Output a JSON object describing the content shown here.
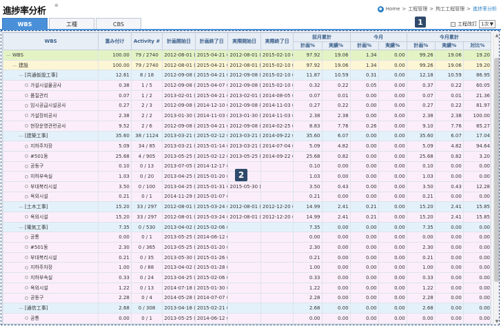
{
  "page": {
    "title": "進捗率分析",
    "title_mark": "⊕",
    "breadcrumb": [
      "Home",
      ">",
      "工程管理",
      ">",
      "拘工工程管理",
      ">",
      "進捗率分析"
    ]
  },
  "tabs": [
    {
      "label": "WBS",
      "active": true
    },
    {
      "label": "工種",
      "active": false
    },
    {
      "label": "CBS",
      "active": false
    }
  ],
  "revision": {
    "label": "工程改訂",
    "value": "1次",
    "arrow": "▼"
  },
  "callouts": [
    "1",
    "2"
  ],
  "table": {
    "header_groups": {
      "wbs": "WBS",
      "weight": "重み付け",
      "activity": "Activity #",
      "plan_start": "計画開始日",
      "plan_end": "計画終了日",
      "act_start": "実際開始日",
      "act_end": "実際終了日",
      "cum_prev": "前月累計",
      "this_month": "今月",
      "cum_this": "今月累計"
    },
    "sub_headers": [
      "計画%",
      "実績%",
      "計画%",
      "実績%",
      "計画%",
      "実績%",
      "対比%"
    ],
    "rows": [
      {
        "level": 0,
        "indent": 0,
        "prefix": "—",
        "wbs": "WBS",
        "weight": "100.00",
        "activity": "79 / 2740",
        "ps": "2012-08-01 (",
        "pe": "2015-04-21 (",
        "as": "2012-08-01 (",
        "ae": "2015-02-10 (",
        "v": [
          "97.92",
          "19.06",
          "1.34",
          "0.00",
          "99.26",
          "19.06",
          "19.20"
        ]
      },
      {
        "level": 1,
        "indent": 1,
        "prefix": "—",
        "wbs": "建設",
        "weight": "100.00",
        "activity": "79 / 2740",
        "ps": "2012-08-01 (",
        "pe": "2015-04-21 (",
        "as": "2012-08-01 (",
        "ae": "2015-02-10 (",
        "v": [
          "97.92",
          "19.06",
          "1.34",
          "0.00",
          "99.26",
          "19.06",
          "19.20"
        ]
      },
      {
        "level": 2,
        "indent": 2,
        "prefix": "—",
        "wbs": "[共通仮設工事]",
        "weight": "12.61",
        "activity": "8 / 18",
        "ps": "2012-09-08 (",
        "pe": "2015-04-21 (",
        "as": "2012-09-08 (",
        "ae": "2015-02-10 (",
        "v": [
          "11.87",
          "10.59",
          "0.31",
          "0.00",
          "12.18",
          "10.59",
          "86.95"
        ]
      },
      {
        "level": 3,
        "indent": 3,
        "prefix": "◇",
        "wbs": "가설시설물공사",
        "weight": "0.38",
        "activity": "1 / 5",
        "ps": "2012-09-08 (",
        "pe": "2015-04-07 (",
        "as": "2012-09-08 (",
        "ae": "2015-02-10 (",
        "v": [
          "0.32",
          "0.22",
          "0.05",
          "0.00",
          "0.37",
          "0.22",
          "60.05"
        ]
      },
      {
        "level": 3,
        "indent": 3,
        "prefix": "◇",
        "wbs": "품질관리",
        "weight": "0.07",
        "activity": "1 / 2",
        "ps": "2013-02-01 (",
        "pe": "2015-04-21 (",
        "as": "2013-02-01 (",
        "ae": "2014-08-05 (",
        "v": [
          "0.07",
          "0.01",
          "0.00",
          "0.00",
          "0.07",
          "0.01",
          "21.36"
        ]
      },
      {
        "level": 3,
        "indent": 3,
        "prefix": "◇",
        "wbs": "임시공급시설공사",
        "weight": "0.27",
        "activity": "2 / 3",
        "ps": "2012-09-08 (",
        "pe": "2014-12-10 (",
        "as": "2012-09-08 (",
        "ae": "2014-11-03 (",
        "v": [
          "0.27",
          "0.22",
          "0.00",
          "0.00",
          "0.27",
          "0.22",
          "81.97"
        ]
      },
      {
        "level": 3,
        "indent": 3,
        "prefix": "◇",
        "wbs": "가설장비공사",
        "weight": "2.38",
        "activity": "2 / 2",
        "ps": "2013-01-30 (",
        "pe": "2014-11-03 (",
        "as": "2013-01-30 (",
        "ae": "2014-11-03 (",
        "v": [
          "2.38",
          "2.38",
          "0.00",
          "0.00",
          "2.38",
          "2.38",
          "100.00"
        ]
      },
      {
        "level": 3,
        "indent": 3,
        "prefix": "◇",
        "wbs": "현장운영관련공사",
        "weight": "9.52",
        "activity": "2 / 6",
        "ps": "2012-09-08 (",
        "pe": "2015-04-21 (",
        "as": "2012-09-08 (",
        "ae": "2014-02-25 (",
        "v": [
          "8.83",
          "7.76",
          "0.26",
          "0.00",
          "9.10",
          "7.76",
          "85.27"
        ]
      },
      {
        "level": 2,
        "indent": 2,
        "prefix": "—",
        "wbs": "[建築工事]",
        "weight": "35.60",
        "activity": "38 / 1124",
        "ps": "2013-03-21 (",
        "pe": "2015-02-12 (",
        "as": "2013-03-21 (",
        "ae": "2014-09-22 (",
        "v": [
          "35.60",
          "6.07",
          "0.00",
          "0.00",
          "35.60",
          "6.07",
          "17.04"
        ]
      },
      {
        "level": 3,
        "indent": 3,
        "prefix": "◇",
        "wbs": "지하주차장",
        "weight": "5.09",
        "activity": "34 / 85",
        "ps": "2013-03-21 (",
        "pe": "2015-01-14 (",
        "as": "2013-03-21 (",
        "ae": "2014-07-04 (",
        "v": [
          "5.09",
          "4.82",
          "0.00",
          "0.00",
          "5.09",
          "4.82",
          "94.64"
        ]
      },
      {
        "level": 3,
        "indent": 3,
        "prefix": "◇",
        "wbs": "#501동",
        "weight": "25.68",
        "activity": "4 / 905",
        "ps": "2013-05-25 (",
        "pe": "2015-02-12 (",
        "as": "2013-05-25 (",
        "ae": "2014-09-22 (",
        "v": [
          "25.68",
          "0.82",
          "0.00",
          "0.00",
          "25.68",
          "0.82",
          "3.20"
        ]
      },
      {
        "level": 3,
        "indent": 3,
        "prefix": "◇",
        "wbs": "공동구",
        "weight": "0.10",
        "activity": "0 / 13",
        "ps": "2013-07-05 (",
        "pe": "2014-12-17 (",
        "as": "",
        "ae": "",
        "v": [
          "0.10",
          "0.00",
          "0.00",
          "0.00",
          "0.10",
          "0.00",
          "0.00"
        ]
      },
      {
        "level": 3,
        "indent": 3,
        "prefix": "◇",
        "wbs": "지하부속실",
        "weight": "1.03",
        "activity": "0 / 20",
        "ps": "2013-04-25 (",
        "pe": "2015-01-20 (",
        "as": "",
        "ae": "",
        "v": [
          "1.03",
          "0.00",
          "0.00",
          "0.00",
          "1.03",
          "0.00",
          "0.00"
        ]
      },
      {
        "level": 3,
        "indent": 3,
        "prefix": "◇",
        "wbs": "부대복리시설",
        "weight": "3.50",
        "activity": "0 / 100",
        "ps": "2013-04-25 (",
        "pe": "2015-01-31 (",
        "as": "2015-05-30 (",
        "ae": "",
        "v": [
          "3.50",
          "0.43",
          "0.00",
          "0.00",
          "3.50",
          "0.43",
          "12.28"
        ]
      },
      {
        "level": 3,
        "indent": 3,
        "prefix": "◇",
        "wbs": "옥외시설",
        "weight": "0.21",
        "activity": "0 / 1",
        "ps": "2014-11-29 (",
        "pe": "2015-01-07 (",
        "as": "",
        "ae": "",
        "v": [
          "0.21",
          "0.00",
          "0.00",
          "0.00",
          "0.21",
          "0.00",
          "0.00"
        ]
      },
      {
        "level": 2,
        "indent": 2,
        "prefix": "—",
        "wbs": "[土木工事]",
        "weight": "15.20",
        "activity": "33 / 297",
        "ps": "2012-08-01 (",
        "pe": "2015-03-24 (",
        "as": "2012-08-01 (",
        "ae": "2012-12-20 (",
        "v": [
          "14.99",
          "2.41",
          "0.21",
          "0.00",
          "15.20",
          "2.41",
          "15.85"
        ]
      },
      {
        "level": 3,
        "indent": 3,
        "prefix": "◇",
        "wbs": "옥외시설",
        "weight": "15.20",
        "activity": "33 / 297",
        "ps": "2012-08-01 (",
        "pe": "2015-03-24 (",
        "as": "2012-08-01 (",
        "ae": "2012-12-20 (",
        "v": [
          "14.99",
          "2.41",
          "0.21",
          "0.00",
          "15.20",
          "2.41",
          "15.85"
        ]
      },
      {
        "level": 2,
        "indent": 2,
        "prefix": "—",
        "wbs": "[電気工事]",
        "weight": "7.35",
        "activity": "0 / 530",
        "ps": "2013-04-02 (",
        "pe": "2015-02-06 (",
        "as": "",
        "ae": "",
        "v": [
          "7.35",
          "0.00",
          "0.00",
          "0.00",
          "7.35",
          "0.00",
          "0.00"
        ]
      },
      {
        "level": 3,
        "indent": 3,
        "prefix": "◇",
        "wbs": "공통",
        "weight": "0.00",
        "activity": "0 / 1",
        "ps": "2013-05-25 (",
        "pe": "2014-06-12 (",
        "as": "",
        "ae": "",
        "v": [
          "0.00",
          "0.00",
          "0.00",
          "0.00",
          "0.00",
          "0.00",
          "0.00"
        ]
      },
      {
        "level": 3,
        "indent": 3,
        "prefix": "◇",
        "wbs": "#501동",
        "weight": "2.30",
        "activity": "0 / 365",
        "ps": "2013-05-25 (",
        "pe": "2015-01-20 (",
        "as": "",
        "ae": "",
        "v": [
          "2.30",
          "0.00",
          "0.00",
          "0.00",
          "2.30",
          "0.00",
          "0.00"
        ]
      },
      {
        "level": 3,
        "indent": 3,
        "prefix": "◇",
        "wbs": "부대복리시설",
        "weight": "0.21",
        "activity": "0 / 35",
        "ps": "2013-05-30 (",
        "pe": "2015-01-26 (",
        "as": "",
        "ae": "",
        "v": [
          "0.21",
          "0.00",
          "0.00",
          "0.00",
          "0.21",
          "0.00",
          "0.00"
        ]
      },
      {
        "level": 3,
        "indent": 3,
        "prefix": "◇",
        "wbs": "지하주차장",
        "weight": "1.00",
        "activity": "0 / 88",
        "ps": "2013-04-02 (",
        "pe": "2015-01-28 (",
        "as": "",
        "ae": "",
        "v": [
          "1.00",
          "0.00",
          "0.00",
          "0.00",
          "1.00",
          "0.00",
          "0.00"
        ]
      },
      {
        "level": 3,
        "indent": 3,
        "prefix": "◇",
        "wbs": "지하부속실",
        "weight": "0.33",
        "activity": "0 / 24",
        "ps": "2013-04-25 (",
        "pe": "2015-02-06 (",
        "as": "",
        "ae": "",
        "v": [
          "0.33",
          "0.00",
          "0.00",
          "0.00",
          "0.33",
          "0.00",
          "0.00"
        ]
      },
      {
        "level": 3,
        "indent": 3,
        "prefix": "◇",
        "wbs": "옥외시설",
        "weight": "1.22",
        "activity": "0 / 13",
        "ps": "2014-07-18 (",
        "pe": "2015-01-30 (",
        "as": "",
        "ae": "",
        "v": [
          "1.22",
          "0.00",
          "0.00",
          "0.00",
          "1.22",
          "0.00",
          "0.00"
        ]
      },
      {
        "level": 3,
        "indent": 3,
        "prefix": "◇",
        "wbs": "공동구",
        "weight": "2.28",
        "activity": "0 / 4",
        "ps": "2014-05-28 (",
        "pe": "2014-07-07 (",
        "as": "",
        "ae": "",
        "v": [
          "2.28",
          "0.00",
          "0.00",
          "0.00",
          "2.28",
          "0.00",
          "0.00"
        ]
      },
      {
        "level": 2,
        "indent": 2,
        "prefix": "—",
        "wbs": "[通信工事]",
        "weight": "2.68",
        "activity": "0 / 308",
        "ps": "2013-04-18 (",
        "pe": "2015-02-21 (",
        "as": "",
        "ae": "",
        "v": [
          "2.68",
          "0.00",
          "0.00",
          "0.00",
          "2.68",
          "0.00",
          "0.00"
        ]
      },
      {
        "level": 3,
        "indent": 3,
        "prefix": "◇",
        "wbs": "공통",
        "weight": "0.00",
        "activity": "0 / 1",
        "ps": "2013-05-25 (",
        "pe": "2014-06-12 (",
        "as": "",
        "ae": "",
        "v": [
          "0.00",
          "0.00",
          "0.00",
          "0.00",
          "0.00",
          "0.00",
          "0.00"
        ]
      }
    ]
  },
  "scrollbar": {
    "up": "▲",
    "down": "▼"
  }
}
